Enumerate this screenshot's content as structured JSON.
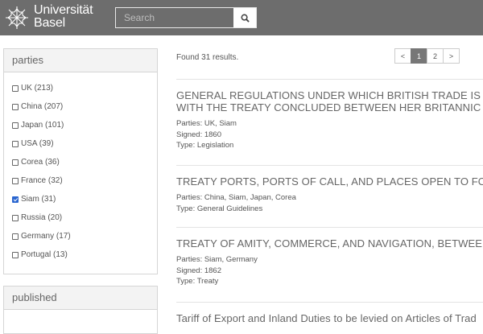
{
  "header": {
    "brand_line1": "Universität",
    "brand_line2": "Basel",
    "search_placeholder": "Search",
    "search_value": ""
  },
  "facets": {
    "parties": {
      "title": "parties",
      "items": [
        {
          "label": "UK (213)",
          "checked": false
        },
        {
          "label": "China (207)",
          "checked": false
        },
        {
          "label": "Japan (101)",
          "checked": false
        },
        {
          "label": "USA (39)",
          "checked": false
        },
        {
          "label": "Corea (36)",
          "checked": false
        },
        {
          "label": "France (32)",
          "checked": false
        },
        {
          "label": "Siam (31)",
          "checked": true
        },
        {
          "label": "Russia (20)",
          "checked": false
        },
        {
          "label": "Germany (17)",
          "checked": false
        },
        {
          "label": "Portugal (13)",
          "checked": false
        }
      ]
    },
    "published": {
      "title": "published"
    }
  },
  "results": {
    "found_text": "Found 31 results.",
    "pagination": {
      "prev": "<",
      "pages": [
        "1",
        "2"
      ],
      "active": "1",
      "next": ">"
    },
    "items": [
      {
        "title1": "GENERAL REGULATIONS UNDER WHICH BRITISH TRADE IS TO B",
        "title2": "WITH THE TREATY CONCLUDED BETWEEN HER BRITANNIC MAJE",
        "parties": "Parties: UK, Siam",
        "signed": "Signed: 1860",
        "type": "Type: Legislation"
      },
      {
        "title1": "TREATY PORTS, PORTS OF CALL, AND PLACES OPEN TO FOREIG",
        "parties": "Parties: China, Siam, Japan, Corea",
        "type": "Type: General Guidelines"
      },
      {
        "title1": "TREATY OF AMITY, COMMERCE, AND NAVIGATION, BETWEEN TH",
        "parties": "Parties: Siam, Germany",
        "signed": "Signed: 1862",
        "type": "Type: Treaty"
      },
      {
        "title1": "Tariff of Export and Inland Duties to be levied on Articles of Trad"
      }
    ]
  }
}
